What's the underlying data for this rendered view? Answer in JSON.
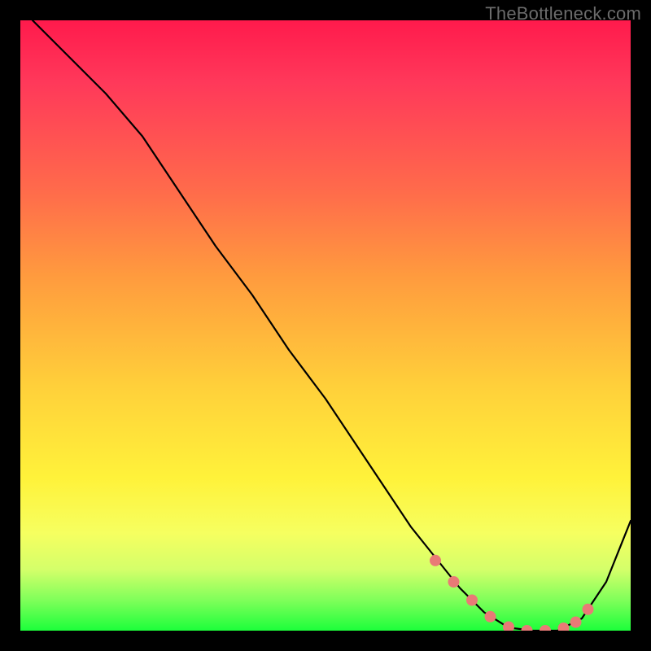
{
  "watermark": "TheBottleneck.com",
  "chart_data": {
    "type": "line",
    "title": "",
    "xlabel": "",
    "ylabel": "",
    "xlim": [
      0,
      100
    ],
    "ylim": [
      0,
      100
    ],
    "series": [
      {
        "name": "curve",
        "x": [
          2,
          6,
          10,
          14,
          20,
          26,
          32,
          38,
          44,
          50,
          56,
          60,
          64,
          68,
          72,
          76,
          80,
          84,
          88,
          92,
          96,
          100
        ],
        "y": [
          100,
          96,
          92,
          88,
          81,
          72,
          63,
          55,
          46,
          38,
          29,
          23,
          17,
          12,
          7,
          3,
          0.5,
          0,
          0,
          2,
          8,
          18
        ]
      }
    ],
    "highlight_dots": {
      "name": "dotted-segment",
      "x": [
        68,
        71,
        74,
        77,
        80,
        83,
        86,
        89,
        91,
        93
      ],
      "y": [
        11.5,
        8,
        5,
        2.3,
        0.6,
        0,
        0,
        0.4,
        1.4,
        3.5
      ]
    },
    "colors": {
      "curve": "#000000",
      "dots": "#e97a76",
      "gradient_top": "#ff1a4c",
      "gradient_bottom": "#1cff3b"
    }
  }
}
